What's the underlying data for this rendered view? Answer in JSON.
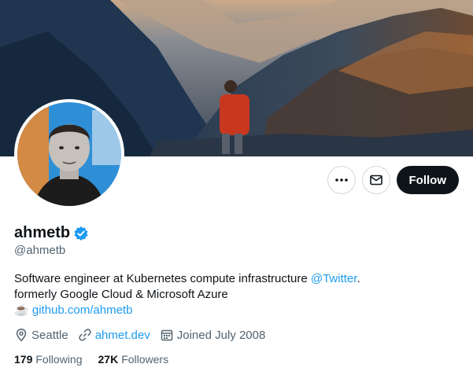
{
  "profile": {
    "display_name": "ahmetb",
    "handle": "@ahmetb",
    "verified_color": "#1d9bf0",
    "bio": {
      "line1_text": "Software engineer at Kubernetes compute infrastructure ",
      "line1_mention": "@Twitter",
      "line1_end": ".",
      "line2": "formerly Google Cloud & Microsoft Azure",
      "line3_emoji": "☕",
      "line3_link": "github.com/ahmetb"
    },
    "meta": {
      "location": "Seattle",
      "website": "ahmet.dev",
      "joined": "Joined July 2008"
    },
    "stats": {
      "following_count": "179",
      "following_label": "Following",
      "followers_count": "27K",
      "followers_label": "Followers"
    }
  },
  "actions": {
    "more_icon": "more-icon",
    "message_icon": "mail-icon",
    "follow_label": "Follow"
  },
  "colors": {
    "accent": "#1d9bf0",
    "text_primary": "#0f1419",
    "text_secondary": "#536471",
    "follow_bg": "#0f1419"
  }
}
